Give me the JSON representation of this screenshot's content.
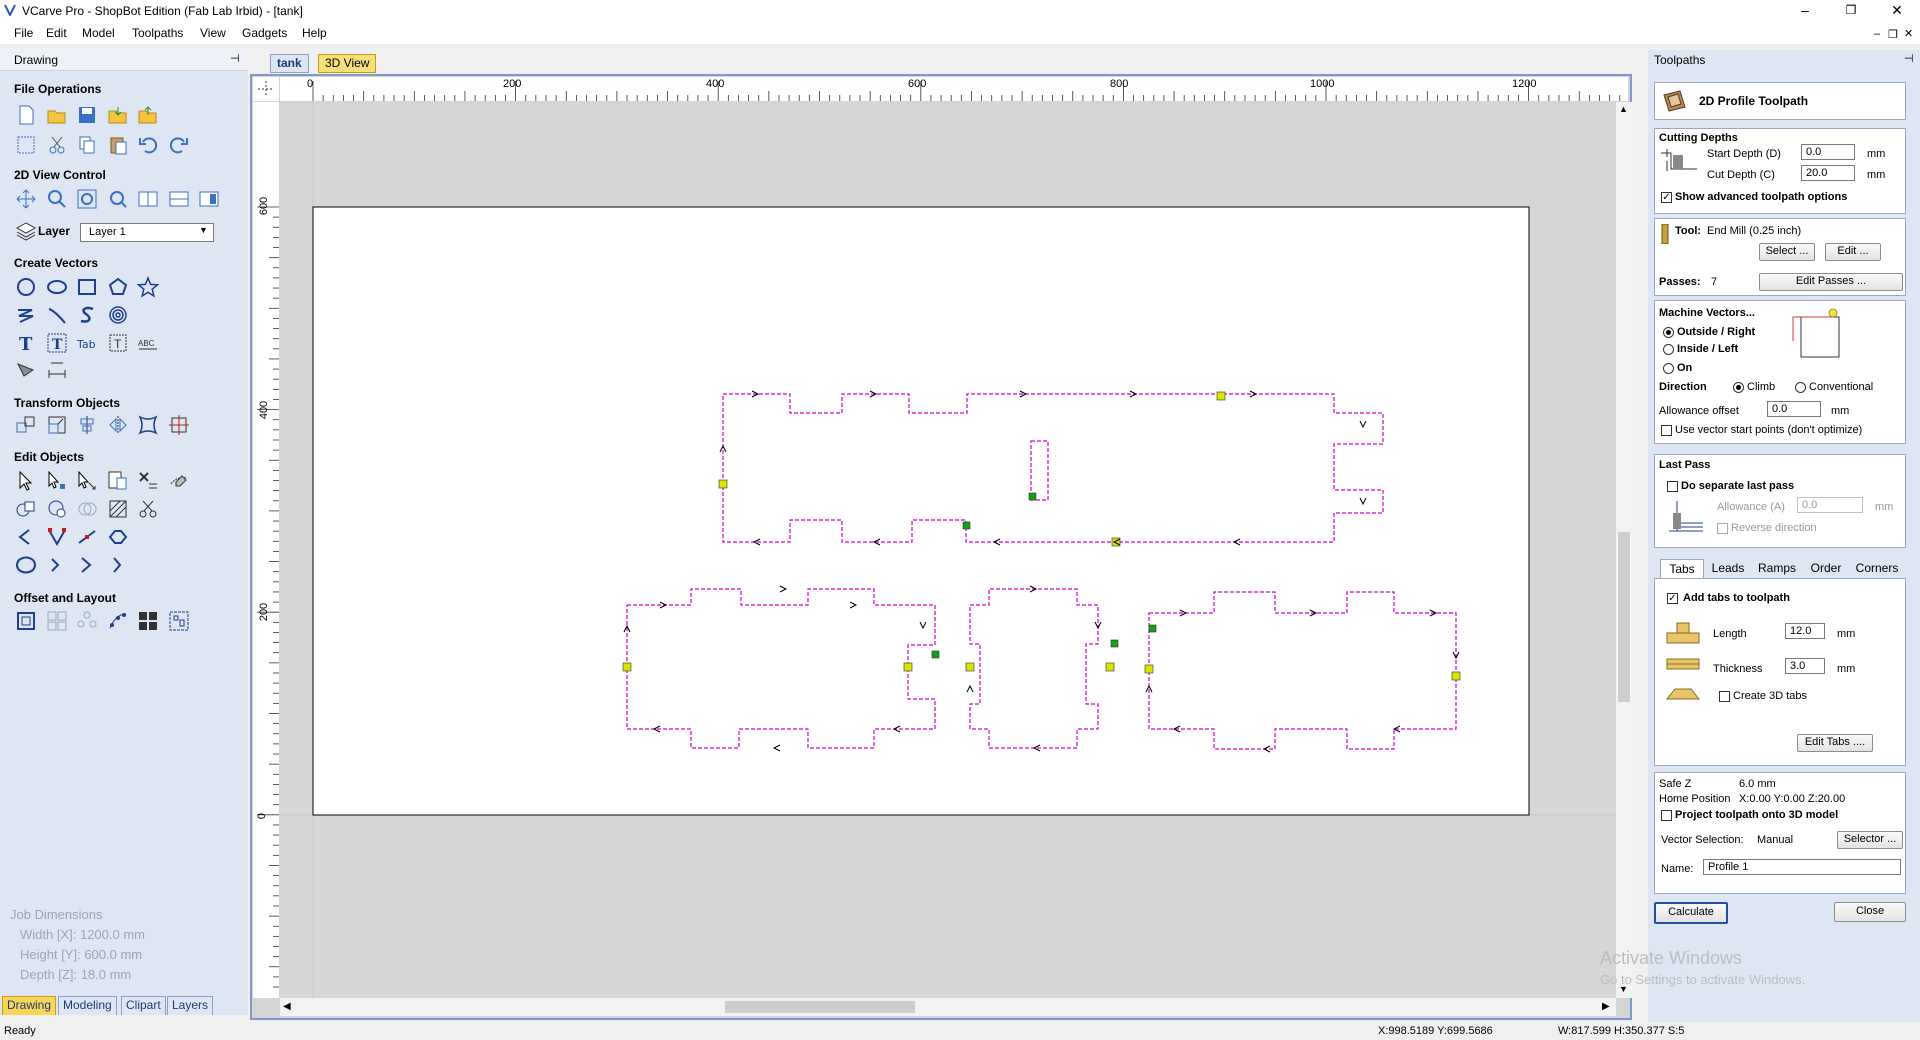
{
  "window": {
    "title": "VCarve Pro - ShopBot Edition (Fab Lab Irbid) - [tank]",
    "min": "–",
    "max": "❐",
    "close": "✕"
  },
  "menu": [
    "File",
    "Edit",
    "Model",
    "Toolpaths",
    "View",
    "Gadgets",
    "Help"
  ],
  "left_panel": {
    "title": "Drawing",
    "pin": "⊣",
    "sections": {
      "file_ops": "File Operations",
      "view_control": "2D View Control",
      "layer": "Layer",
      "create_vectors": "Create Vectors",
      "transform": "Transform Objects",
      "edit": "Edit Objects",
      "offset": "Offset and Layout"
    },
    "layer_value": "Layer 1",
    "job_dims": {
      "title": "Job Dimensions",
      "width": "Width  [X]: 1200.0 mm",
      "height": "Height [Y]: 600.0 mm",
      "depth": "Depth  [Z]: 18.0 mm"
    },
    "bottom_tabs": [
      "Drawing",
      "Modeling",
      "Clipart",
      "Layers"
    ]
  },
  "doc_tabs": [
    "tank",
    "3D View"
  ],
  "rulers": {
    "h": [
      "0",
      "200",
      "400",
      "600",
      "800",
      "1000",
      "1200"
    ],
    "v": [
      "600",
      "400",
      "200",
      "0"
    ]
  },
  "status": {
    "left": "Ready",
    "coords": "X:998.5189 Y:699.5686",
    "size": "W:817.599  H:350.377  S:5"
  },
  "watermark": {
    "line1": "Activate Windows",
    "line2": "Go to Settings to activate Windows."
  },
  "right_panel": {
    "title": "Toolpaths",
    "pin": "⊣",
    "header": "2D Profile Toolpath",
    "cutting_depths": "Cutting Depths",
    "start_depth_label": "Start Depth (D)",
    "start_depth": "0.0",
    "cut_depth_label": "Cut Depth (C)",
    "cut_depth": "20.0",
    "unit": "mm",
    "show_advanced": "Show advanced toolpath options",
    "tool_label": "Tool:",
    "tool_value": "End Mill (0.25 inch)",
    "select_btn": "Select ...",
    "edit_btn": "Edit ...",
    "passes_label": "Passes:",
    "passes_value": "7",
    "edit_passes_btn": "Edit Passes ...",
    "machine_vectors": "Machine Vectors...",
    "outside_right": "Outside / Right",
    "inside_left": "Inside / Left",
    "on": "On",
    "direction": "Direction",
    "climb": "Climb",
    "conventional": "Conventional",
    "allowance_offset": "Allowance offset",
    "allowance_value": "0.0",
    "use_vector_start": "Use vector start points (don't optimize)",
    "last_pass": "Last Pass",
    "do_separate": "Do separate last pass",
    "allowance_a": "Allowance (A)",
    "allowance_a_value": "0.0",
    "reverse_direction": "Reverse direction",
    "tabs": [
      "Tabs",
      "Leads",
      "Ramps",
      "Order",
      "Corners"
    ],
    "add_tabs": "Add tabs to toolpath",
    "length_label": "Length",
    "length_value": "12.0",
    "thickness_label": "Thickness",
    "thickness_value": "3.0",
    "create_3d_tabs": "Create 3D tabs",
    "edit_tabs_btn": "Edit Tabs ....",
    "safe_z_label": "Safe Z",
    "safe_z_value": "6.0 mm",
    "home_label": "Home Position",
    "home_value": "X:0.00 Y:0.00 Z:20.00",
    "project_toolpath": "Project toolpath onto 3D model",
    "vector_selection_label": "Vector Selection:",
    "vector_selection_value": "Manual",
    "selector_btn": "Selector ...",
    "name_label": "Name:",
    "name_value": "Profile 1",
    "calculate_btn": "Calculate",
    "close_btn": "Close"
  },
  "colors": {
    "accent": "#1f4fa3",
    "path": "#d200d2",
    "tab_marker": "#d6e400",
    "start_marker": "#14a014",
    "panel": "#dde6f2"
  }
}
